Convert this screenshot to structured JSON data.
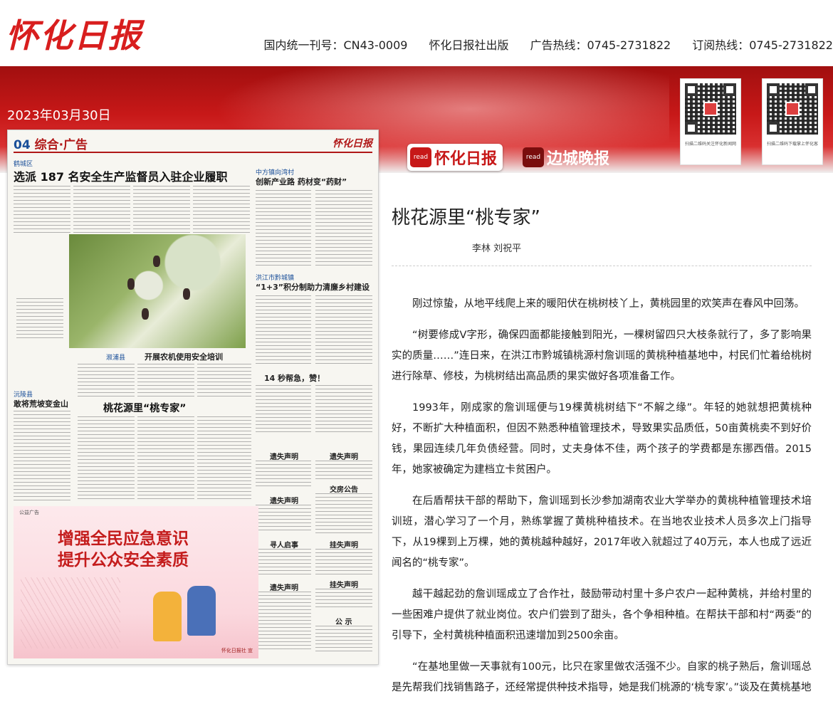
{
  "header": {
    "logo": "怀化日报",
    "publication_number": "国内统一刊号：CN43-0009",
    "publisher": "怀化日报社出版",
    "ad_hotline": "广告热线：0745-2731822",
    "subscription_hotline": "订阅热线：0745-2731822"
  },
  "band": {
    "date": "2023年03月30日",
    "qr_left_caption": "扫描二维码关注怀化新闻网官方公众号",
    "qr_right_caption": "扫描二维码下载掌上怀化客户端"
  },
  "tabs": [
    {
      "label": "怀化日报",
      "icon": "read",
      "active": true
    },
    {
      "label": "边城晚报",
      "icon": "read",
      "active": false
    }
  ],
  "paper": {
    "page_num": "04",
    "page_section": "综合·广告",
    "header_logo": "怀化日报",
    "kicker_1": "鹤城区",
    "headline_1": "选派 187 名安全生产监督员入驻企业履职",
    "kicker_2": "中方镇向湾村",
    "headline_2": "创新产业路  药材变“药财”",
    "kicker_3": "洪江市黔城镇",
    "headline_3": "“1+3”积分制助力清廉乡村建设",
    "kicker_4": "溆浦县",
    "headline_4": "开展农机使用安全培训",
    "headline_5": "14 秒帮急，赞！",
    "kicker_6": "沅陵县",
    "headline_6": "敢将荒坡变金山",
    "headline_7": "桃花源里“桃专家”",
    "ad_tag": "公益广告",
    "ad_line_1": "增强全民应急意识",
    "ad_line_2": "提升公众安全素质",
    "ad_footer": "怀化日报社  宣",
    "notices": [
      "遗失声明",
      "遗失声明",
      "遗失声明",
      "交房公告",
      "寻人启事",
      "挂失声明",
      "遗失声明",
      "挂失声明",
      "公  示"
    ]
  },
  "article": {
    "title": "桃花源里“桃专家”",
    "author": "李林 刘祝平",
    "paragraphs": [
      "刚过惊蛰，从地平线爬上来的暖阳伏在桃树枝丫上，黄桃园里的欢笑声在春风中回荡。",
      "“树要修成V字形，确保四面都能接触到阳光，一棵树留四只大枝条就行了，多了影响果实的质量……”连日来，在洪江市黔城镇桃源村詹训瑶的黄桃种植基地中，村民们忙着给桃树进行除草、修枝，为桃树结出高品质的果实做好各项准备工作。",
      "1993年，刚成家的詹训瑶便与19棵黄桃树结下“不解之缘”。年轻的她就想把黄桃种好，不断扩大种植面积，但因不熟悉种植管理技术，导致果实品质低，50亩黄桃卖不到好价钱，果园连续几年负债经营。同时，丈夫身体不佳，两个孩子的学费都是东挪西借。2015年，她家被确定为建档立卡贫困户。",
      "在后盾帮扶干部的帮助下，詹训瑶到长沙参加湖南农业大学举办的黄桃种植管理技术培训班，潜心学习了一个月，熟练掌握了黄桃种植技术。在当地农业技术人员多次上门指导下，从19棵到上万棵，她的黄桃越种越好，2017年收入就超过了40万元，本人也成了远近闻名的“桃专家”。",
      "越干越起劲的詹训瑶成立了合作社，鼓励带动村里十多户农户一起种黄桃，并给村里的一些困难户提供了就业岗位。农户们尝到了甜头，各个争相种植。在帮扶干部和村“两委”的引导下，全村黄桃种植面积迅速增加到2500余亩。",
      "“在基地里做一天事就有100元，比只在家里做农活强不少。自家的桃子熟后，詹训瑶总是先帮我们找销售路子，还经常提供种技术指导，她是我们桃源的‘桃专家’。”谈及在黄桃基地"
    ]
  }
}
